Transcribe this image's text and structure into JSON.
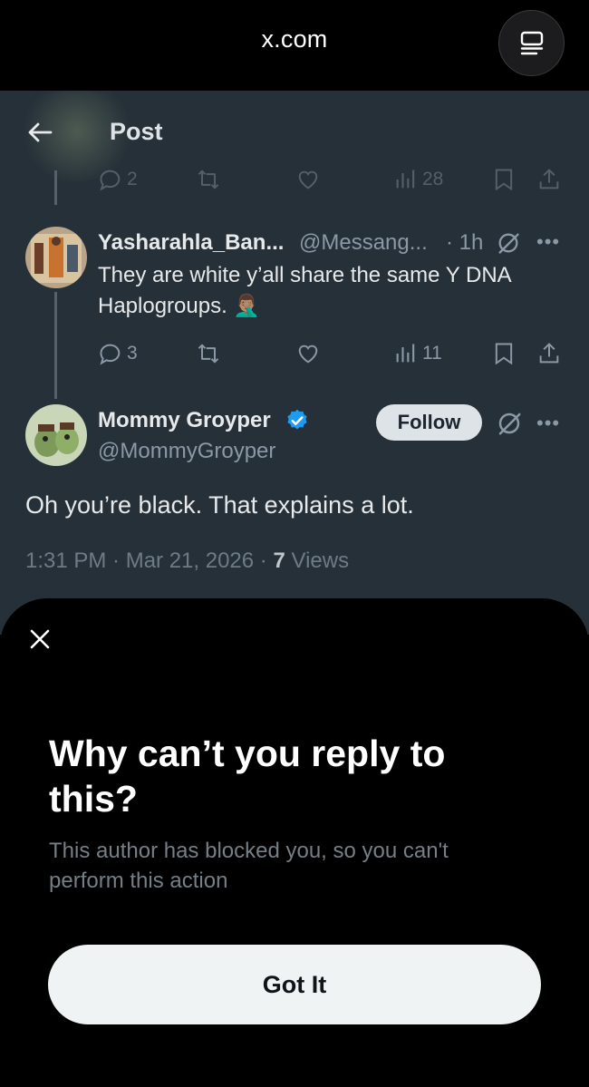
{
  "browser": {
    "url": "x.com",
    "tabs_icon": "tabs-icon"
  },
  "header": {
    "title": "Post",
    "back_icon": "arrow-left-icon"
  },
  "prev_tweet_actions": {
    "replies": "2",
    "views": "28"
  },
  "reply_tweet": {
    "name": "Yasharahla_Ban...",
    "handle": "@Messang...",
    "time": "· 1h",
    "text_line1": "They are white y’all share the same Y DNA",
    "text_line2": "Haplogroups. 🤦🏽‍♂️",
    "replies": "3",
    "views": "11"
  },
  "main_tweet": {
    "name": "Mommy Groyper",
    "handle": "@MommyGroyper",
    "follow_label": "Follow",
    "text": "Oh you’re black. That explains a lot.",
    "meta_time": "1:31 PM · Mar 21, 2026 · ",
    "meta_views_count": "7",
    "meta_views_label": " Views"
  },
  "sheet": {
    "title": "Why can’t you reply to this?",
    "description": "This author has blocked you, so you can't perform this action",
    "button_label": "Got It"
  },
  "colors": {
    "page_bg": "#253038",
    "verified": "#1d9bf0",
    "muted_text": "#8b98a5",
    "sheet_bg": "#000000",
    "button_bg": "#eff3f4"
  }
}
